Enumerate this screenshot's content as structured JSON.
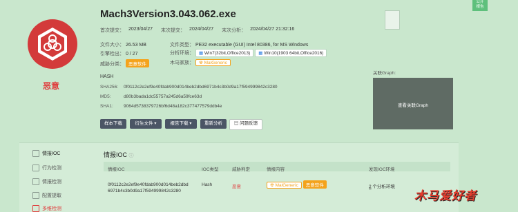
{
  "file": {
    "name": "Mach3Version3.043.062.exe",
    "verdict": "恶意"
  },
  "meta": {
    "first_submit_label": "首次提交：",
    "first_submit": "2023/04/27",
    "last_submit_label": "末次提交：",
    "last_submit": "2024/04/27",
    "last_analysis_label": "末次分析：",
    "last_analysis": "2024/04/27 21:32:16"
  },
  "details": {
    "size_label": "文件大小：",
    "size": "26.53 MB",
    "engine_label": "引擎检出：",
    "engine": "0 / 27",
    "threat_label": "威胁分类：",
    "threat": "恶意软件",
    "type_label": "文件类型：",
    "type": "PE32 executable (GUI) Intel 80386, for MS Windows",
    "env_label": "分析环境：",
    "env1": "Win7(32bit,Office2013)",
    "env2": "Win10(1903 64bit,Office2016)",
    "family_label": "木马家族：",
    "family": "MalGeneric"
  },
  "hash": {
    "title": "HASH",
    "sha256_label": "SHA256:",
    "sha256": "0f0112c2e2ef9e40fdab900d014beb2dbd6971b4c3b0d9a17f594999842c3280",
    "md5_label": "MD5:",
    "md5": "d80b3bada1dc55757a245d6a59fce63d",
    "sha1_label": "SHA1:",
    "sha1": "9064d5738379726bf6d48a182c377477579ddb4e"
  },
  "actions": {
    "sample_download": "样本下载",
    "derived_files": "衍生文件",
    "report_download": "报告下载",
    "reanalyze": "重新分析",
    "feedback": "问题反馈"
  },
  "graph": {
    "label": "关联Graph:",
    "view": "查看关联Graph"
  },
  "report_btn": "公开\n报告",
  "sidebar": {
    "items": [
      {
        "label": "情报IOC"
      },
      {
        "label": "行为检测"
      },
      {
        "label": "情报检测"
      },
      {
        "label": "配置提取"
      },
      {
        "label": "多维检测"
      }
    ]
  },
  "ioc": {
    "title": "情报IOC",
    "headers": [
      "情报IOC",
      "IOC类型",
      "威胁判定",
      "情报内容",
      "发现IOC环境"
    ],
    "row": {
      "ioc_line1": "0f0112c2e2ef9e40fdab900d014beb2dbd",
      "ioc_line2": "6971b4c3b0d9a17f594999842c3280",
      "type": "Hash",
      "verdict": "恶意",
      "content_tag1": "MalGeneric",
      "content_tag2": "恶意软件",
      "env_count": "2",
      "env_suffix": " 个分析环境"
    }
  },
  "watermark": "木马爱好者",
  "colors": {
    "bg": "#c9e7cd",
    "malicious": "#e03c3c",
    "orange": "#f4a31c",
    "button": "#4b5565"
  }
}
